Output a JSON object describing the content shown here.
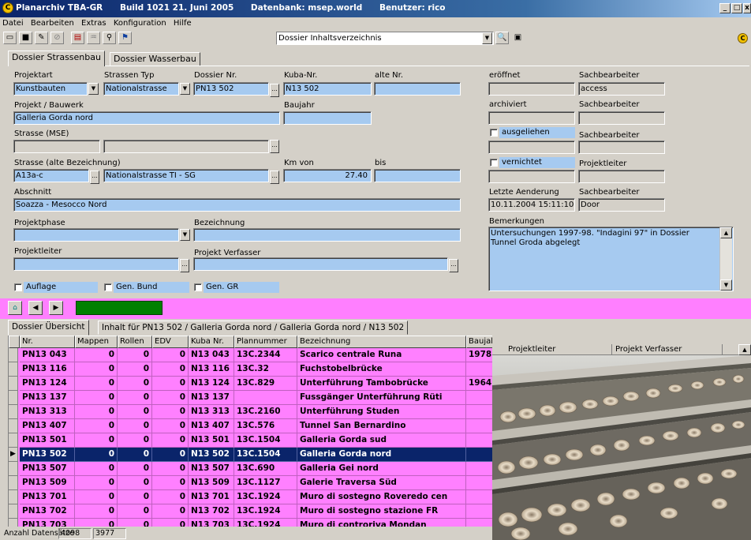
{
  "window": {
    "app_name": "Planarchiv TBA-GR",
    "build": "Build 1021 21. Juni 2005",
    "database": "Datenbank: msep.world",
    "user": "Benutzer: rico",
    "min": "_",
    "max": "□",
    "close": "x"
  },
  "menu": [
    "Datei",
    "Bearbeiten",
    "Extras",
    "Konfiguration",
    "Hilfe"
  ],
  "toolbar": {
    "report_select": "Dossier Inhaltsverzeichnis"
  },
  "tabs": [
    "Dossier Strassenbau",
    "Dossier Wasserbau"
  ],
  "form": {
    "projektart_label": "Projektart",
    "projektart_value": "Kunstbauten",
    "strassentyp_label": "Strassen Typ",
    "strassentyp_value": "Nationalstrasse",
    "dossiernr_label": "Dossier Nr.",
    "dossiernr_value": "PN13 502",
    "kubanr_label": "Kuba-Nr.",
    "kubanr_value": "N13 502",
    "altenr_label": "alte Nr.",
    "altenr_value": "",
    "projekt_label": "Projekt / Bauwerk",
    "projekt_value": "Galleria Gorda nord",
    "baujahr_label": "Baujahr",
    "baujahr_value": "",
    "strasse_mse_label": "Strasse (MSE)",
    "strasse_alt_label": "Strasse (alte Bezeichnung)",
    "strasse_alt_code": "A13a-c",
    "strasse_alt_name": "Nationalstrasse TI - SG",
    "kmvon_label": "Km von",
    "kmvon_value": "27.40",
    "bis_label": "bis",
    "bis_value": "",
    "abschnitt_label": "Abschnitt",
    "abschnitt_value": "Soazza - Mesocco Nord",
    "projektphase_label": "Projektphase",
    "bezeichnung_label": "Bezeichnung",
    "projektleiter_label": "Projektleiter",
    "verfasser_label": "Projekt Verfasser",
    "auflage_label": "Auflage",
    "genbund_label": "Gen. Bund",
    "gengr_label": "Gen. GR",
    "eroeffnet_label": "eröffnet",
    "sachbearbeiter_label": "Sachbearbeiter",
    "sachbearbeiter1_value": "access",
    "archiviert_label": "archiviert",
    "ausgeliehen_label": "ausgeliehen",
    "vernichtet_label": "vernichtet",
    "projektleiter2_label": "Projektleiter",
    "letzte_label": "Letzte Aenderung",
    "letzte_value": "10.11.2004 15:11:10",
    "letzte_sb_value": "Door",
    "bemerkungen_label": "Bemerkungen",
    "bemerkungen_value": "Untersuchungen 1997-98. \"Indagini 97\" in Dossier Tunnel Groda abgelegt"
  },
  "bottom_tabs": [
    "Dossier Übersicht",
    "Inhalt für PN13 502 / Galleria Gorda nord  / Galleria Gorda nord  / N13 502"
  ],
  "grid": {
    "columns": [
      "Nr.",
      "Mappen",
      "Rollen",
      "EDV",
      "Kuba Nr.",
      "Plannummer",
      "Bezeichnung",
      "Baujahr",
      "Projektleiter",
      "Projekt Verfasser"
    ],
    "rows": [
      [
        "PN13 043",
        "0",
        "0",
        "0",
        "N13 043",
        "13C.2344",
        "Scarico centrale Runa",
        "1978"
      ],
      [
        "PN13 116",
        "0",
        "0",
        "0",
        "N13 116",
        "13C.32",
        "Fuchstobelbrücke",
        ""
      ],
      [
        "PN13 124",
        "0",
        "0",
        "0",
        "N13 124",
        "13C.829",
        "Unterführung Tambobrücke",
        "1964"
      ],
      [
        "PN13 137",
        "0",
        "0",
        "0",
        "N13 137",
        "",
        "Fussgänger Unterführung  Rüti",
        ""
      ],
      [
        "PN13 313",
        "0",
        "0",
        "0",
        "N13 313",
        "13C.2160",
        "Unterführung Studen",
        ""
      ],
      [
        "PN13 407",
        "0",
        "0",
        "0",
        "N13 407",
        "13C.576",
        "Tunnel San Bernardino",
        ""
      ],
      [
        "PN13 501",
        "0",
        "0",
        "0",
        "N13 501",
        "13C.1504",
        "Galleria Gorda sud",
        ""
      ],
      [
        "PN13 502",
        "0",
        "0",
        "0",
        "N13 502",
        "13C.1504",
        "Galleria Gorda nord",
        ""
      ],
      [
        "PN13 507",
        "0",
        "0",
        "0",
        "N13 507",
        "13C.690",
        "Galleria Gei nord",
        ""
      ],
      [
        "PN13 509",
        "0",
        "0",
        "0",
        "N13 509",
        "13C.1127",
        "Galerie Traversa Süd",
        ""
      ],
      [
        "PN13 701",
        "0",
        "0",
        "0",
        "N13 701",
        "13C.1924",
        "Muro di sostegno  Roveredo cen",
        ""
      ],
      [
        "PN13 702",
        "0",
        "0",
        "0",
        "N13 702",
        "13C.1924",
        "Muro di sostegno  stazione FR",
        ""
      ],
      [
        "PN13 703",
        "0",
        "0",
        "0",
        "N13 703",
        "13C.1924",
        "Muro di controriva  Mondan",
        ""
      ]
    ],
    "selected_index": 7
  },
  "status": {
    "label": "Anzahl Datensätze",
    "total": "4098",
    "current": "3977"
  },
  "colors": {
    "field_blue": "#a6caf0",
    "magenta": "#ff7fff",
    "selection": "#0a246a",
    "progress": "#008000"
  }
}
